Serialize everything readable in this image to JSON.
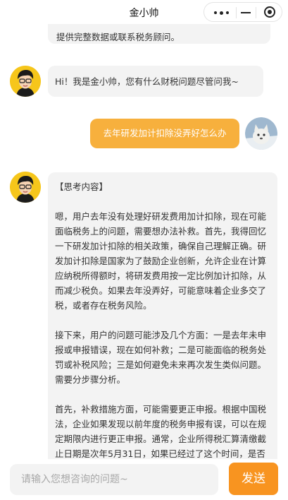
{
  "header": {
    "title": "金小帅"
  },
  "messages": {
    "prev_tail": "提供完整数据或联系税务顾问。",
    "greeting": "Hi！我是金小帅，您有什么财税问题尽管问我~",
    "user_question": "去年研发加计扣除没弄好怎么办",
    "thinking": {
      "heading": "【思考内容】",
      "p1": "嗯，用户去年没有处理好研发费用加计扣除，现在可能面临税务上的问题，需要想办法补救。首先，我得回忆一下研发加计扣除的相关政策，确保自己理解正确。研发加计扣除是国家为了鼓励企业创新，允许企业在计算应纳税所得额时，将研发费用按一定比例加计扣除，从而减少税负。如果去年没弄好，可能意味着企业多交了税，或者存在税务风险。",
      "p2": "接下来，用户的问题可能涉及几个方面：一是去年未申报或申报错误，现在如何补救；二是可能面临的税务处罚或补税风险；三是如何避免未来再次发生类似问题。需要分步骤分析。",
      "p3": "首先，补救措施方面，可能需要更正申报。根据中国税法，企业如果发现以前年度的税务申报有误，可以在规定期限内进行更正申报。通常，企业所得税汇算清缴截止日期是次年5月31日，如果已经过了这个时间，是否还能更正？可能需要查阅相关规定。"
    }
  },
  "composer": {
    "placeholder": "请输入您想咨询的问题~",
    "send_label": "发送"
  },
  "colors": {
    "accent": "#f89420",
    "user_bubble": "#f7b03d",
    "ai_bubble": "#f3f3f3",
    "avatar_bg": "#f6c61b"
  }
}
